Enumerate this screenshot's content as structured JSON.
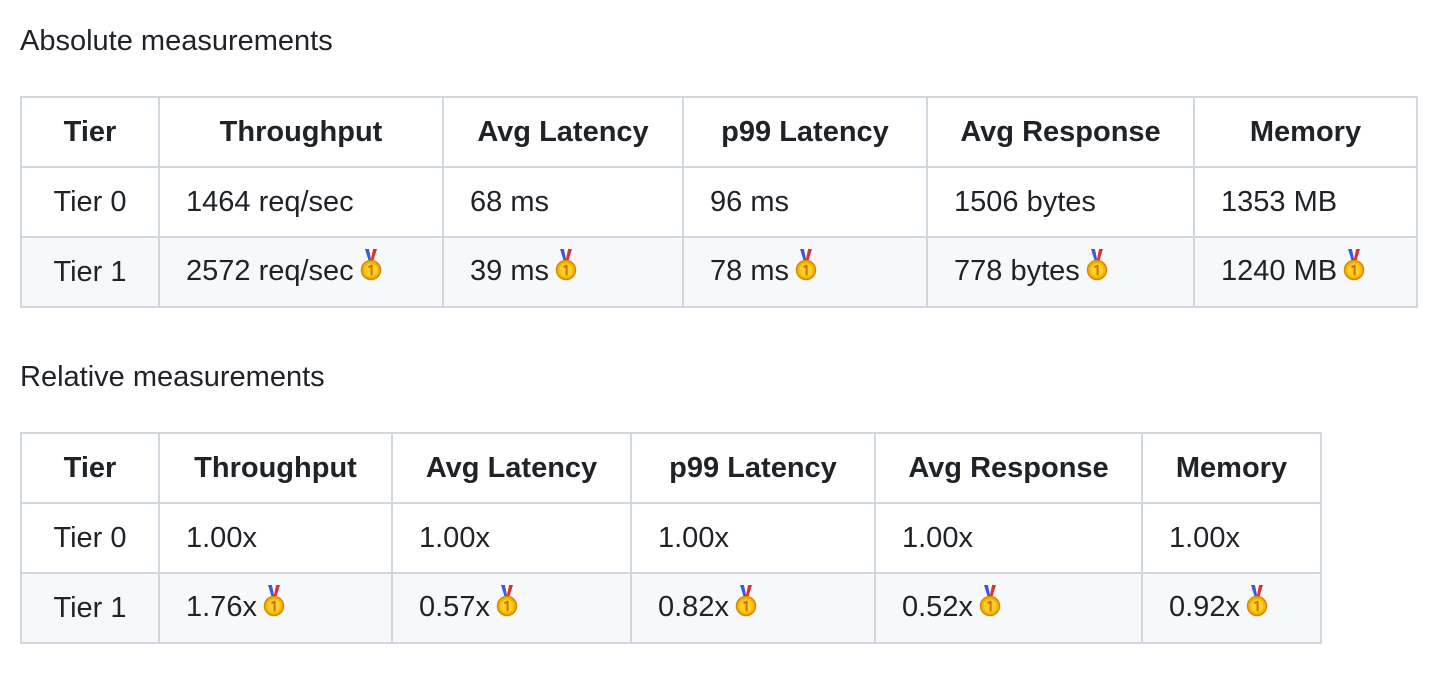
{
  "absolute": {
    "heading": "Absolute measurements",
    "headers": [
      "Tier",
      "Throughput",
      "Avg Latency",
      "p99 Latency",
      "Avg Response",
      "Memory"
    ],
    "rows": [
      [
        "Tier 0",
        "1464 req/sec",
        "68 ms",
        "96 ms",
        "1506 bytes",
        "1353 MB"
      ],
      [
        "Tier 1",
        "2572 req/sec",
        "39 ms",
        "78 ms",
        "778 bytes",
        "1240 MB"
      ]
    ],
    "column_widths": [
      138,
      284,
      240,
      244,
      267,
      223
    ]
  },
  "relative": {
    "heading": "Relative measurements",
    "headers": [
      "Tier",
      "Throughput",
      "Avg Latency",
      "p99 Latency",
      "Avg Response",
      "Memory"
    ],
    "rows": [
      [
        "Tier 0",
        "1.00x",
        "1.00x",
        "1.00x",
        "1.00x",
        "1.00x"
      ],
      [
        "Tier 1",
        "1.76x",
        "0.57x",
        "0.82x",
        "0.52x",
        "0.92x"
      ]
    ],
    "column_widths": [
      138,
      233,
      239,
      244,
      267,
      179
    ]
  },
  "icons": {
    "winner": "first-place-medal-icon"
  },
  "colors": {
    "border": "#d0d7de",
    "alt_row": "#f6f8fa",
    "text": "#1f2328",
    "medal_gold": "#f5b400"
  }
}
